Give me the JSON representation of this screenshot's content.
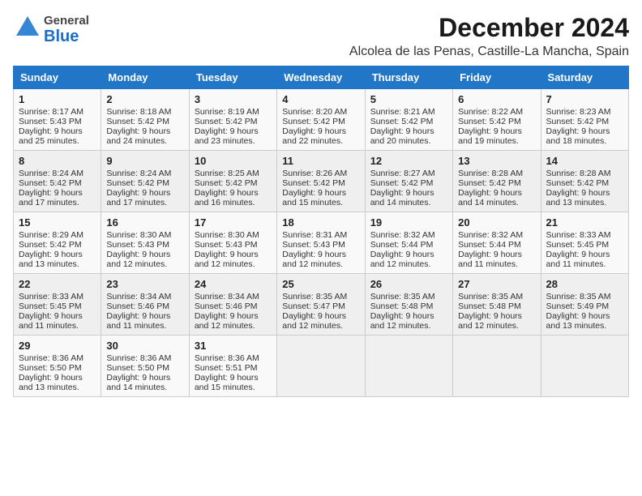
{
  "header": {
    "logo_general": "General",
    "logo_blue": "Blue",
    "title": "December 2024",
    "subtitle": "Alcolea de las Penas, Castille-La Mancha, Spain"
  },
  "days_of_week": [
    "Sunday",
    "Monday",
    "Tuesday",
    "Wednesday",
    "Thursday",
    "Friday",
    "Saturday"
  ],
  "weeks": [
    [
      {
        "day": "1",
        "sunrise": "Sunrise: 8:17 AM",
        "sunset": "Sunset: 5:43 PM",
        "daylight": "Daylight: 9 hours and 25 minutes."
      },
      {
        "day": "2",
        "sunrise": "Sunrise: 8:18 AM",
        "sunset": "Sunset: 5:42 PM",
        "daylight": "Daylight: 9 hours and 24 minutes."
      },
      {
        "day": "3",
        "sunrise": "Sunrise: 8:19 AM",
        "sunset": "Sunset: 5:42 PM",
        "daylight": "Daylight: 9 hours and 23 minutes."
      },
      {
        "day": "4",
        "sunrise": "Sunrise: 8:20 AM",
        "sunset": "Sunset: 5:42 PM",
        "daylight": "Daylight: 9 hours and 22 minutes."
      },
      {
        "day": "5",
        "sunrise": "Sunrise: 8:21 AM",
        "sunset": "Sunset: 5:42 PM",
        "daylight": "Daylight: 9 hours and 20 minutes."
      },
      {
        "day": "6",
        "sunrise": "Sunrise: 8:22 AM",
        "sunset": "Sunset: 5:42 PM",
        "daylight": "Daylight: 9 hours and 19 minutes."
      },
      {
        "day": "7",
        "sunrise": "Sunrise: 8:23 AM",
        "sunset": "Sunset: 5:42 PM",
        "daylight": "Daylight: 9 hours and 18 minutes."
      }
    ],
    [
      {
        "day": "8",
        "sunrise": "Sunrise: 8:24 AM",
        "sunset": "Sunset: 5:42 PM",
        "daylight": "Daylight: 9 hours and 17 minutes."
      },
      {
        "day": "9",
        "sunrise": "Sunrise: 8:24 AM",
        "sunset": "Sunset: 5:42 PM",
        "daylight": "Daylight: 9 hours and 17 minutes."
      },
      {
        "day": "10",
        "sunrise": "Sunrise: 8:25 AM",
        "sunset": "Sunset: 5:42 PM",
        "daylight": "Daylight: 9 hours and 16 minutes."
      },
      {
        "day": "11",
        "sunrise": "Sunrise: 8:26 AM",
        "sunset": "Sunset: 5:42 PM",
        "daylight": "Daylight: 9 hours and 15 minutes."
      },
      {
        "day": "12",
        "sunrise": "Sunrise: 8:27 AM",
        "sunset": "Sunset: 5:42 PM",
        "daylight": "Daylight: 9 hours and 14 minutes."
      },
      {
        "day": "13",
        "sunrise": "Sunrise: 8:28 AM",
        "sunset": "Sunset: 5:42 PM",
        "daylight": "Daylight: 9 hours and 14 minutes."
      },
      {
        "day": "14",
        "sunrise": "Sunrise: 8:28 AM",
        "sunset": "Sunset: 5:42 PM",
        "daylight": "Daylight: 9 hours and 13 minutes."
      }
    ],
    [
      {
        "day": "15",
        "sunrise": "Sunrise: 8:29 AM",
        "sunset": "Sunset: 5:42 PM",
        "daylight": "Daylight: 9 hours and 13 minutes."
      },
      {
        "day": "16",
        "sunrise": "Sunrise: 8:30 AM",
        "sunset": "Sunset: 5:43 PM",
        "daylight": "Daylight: 9 hours and 12 minutes."
      },
      {
        "day": "17",
        "sunrise": "Sunrise: 8:30 AM",
        "sunset": "Sunset: 5:43 PM",
        "daylight": "Daylight: 9 hours and 12 minutes."
      },
      {
        "day": "18",
        "sunrise": "Sunrise: 8:31 AM",
        "sunset": "Sunset: 5:43 PM",
        "daylight": "Daylight: 9 hours and 12 minutes."
      },
      {
        "day": "19",
        "sunrise": "Sunrise: 8:32 AM",
        "sunset": "Sunset: 5:44 PM",
        "daylight": "Daylight: 9 hours and 12 minutes."
      },
      {
        "day": "20",
        "sunrise": "Sunrise: 8:32 AM",
        "sunset": "Sunset: 5:44 PM",
        "daylight": "Daylight: 9 hours and 11 minutes."
      },
      {
        "day": "21",
        "sunrise": "Sunrise: 8:33 AM",
        "sunset": "Sunset: 5:45 PM",
        "daylight": "Daylight: 9 hours and 11 minutes."
      }
    ],
    [
      {
        "day": "22",
        "sunrise": "Sunrise: 8:33 AM",
        "sunset": "Sunset: 5:45 PM",
        "daylight": "Daylight: 9 hours and 11 minutes."
      },
      {
        "day": "23",
        "sunrise": "Sunrise: 8:34 AM",
        "sunset": "Sunset: 5:46 PM",
        "daylight": "Daylight: 9 hours and 11 minutes."
      },
      {
        "day": "24",
        "sunrise": "Sunrise: 8:34 AM",
        "sunset": "Sunset: 5:46 PM",
        "daylight": "Daylight: 9 hours and 12 minutes."
      },
      {
        "day": "25",
        "sunrise": "Sunrise: 8:35 AM",
        "sunset": "Sunset: 5:47 PM",
        "daylight": "Daylight: 9 hours and 12 minutes."
      },
      {
        "day": "26",
        "sunrise": "Sunrise: 8:35 AM",
        "sunset": "Sunset: 5:48 PM",
        "daylight": "Daylight: 9 hours and 12 minutes."
      },
      {
        "day": "27",
        "sunrise": "Sunrise: 8:35 AM",
        "sunset": "Sunset: 5:48 PM",
        "daylight": "Daylight: 9 hours and 12 minutes."
      },
      {
        "day": "28",
        "sunrise": "Sunrise: 8:35 AM",
        "sunset": "Sunset: 5:49 PM",
        "daylight": "Daylight: 9 hours and 13 minutes."
      }
    ],
    [
      {
        "day": "29",
        "sunrise": "Sunrise: 8:36 AM",
        "sunset": "Sunset: 5:50 PM",
        "daylight": "Daylight: 9 hours and 13 minutes."
      },
      {
        "day": "30",
        "sunrise": "Sunrise: 8:36 AM",
        "sunset": "Sunset: 5:50 PM",
        "daylight": "Daylight: 9 hours and 14 minutes."
      },
      {
        "day": "31",
        "sunrise": "Sunrise: 8:36 AM",
        "sunset": "Sunset: 5:51 PM",
        "daylight": "Daylight: 9 hours and 15 minutes."
      },
      null,
      null,
      null,
      null
    ]
  ]
}
